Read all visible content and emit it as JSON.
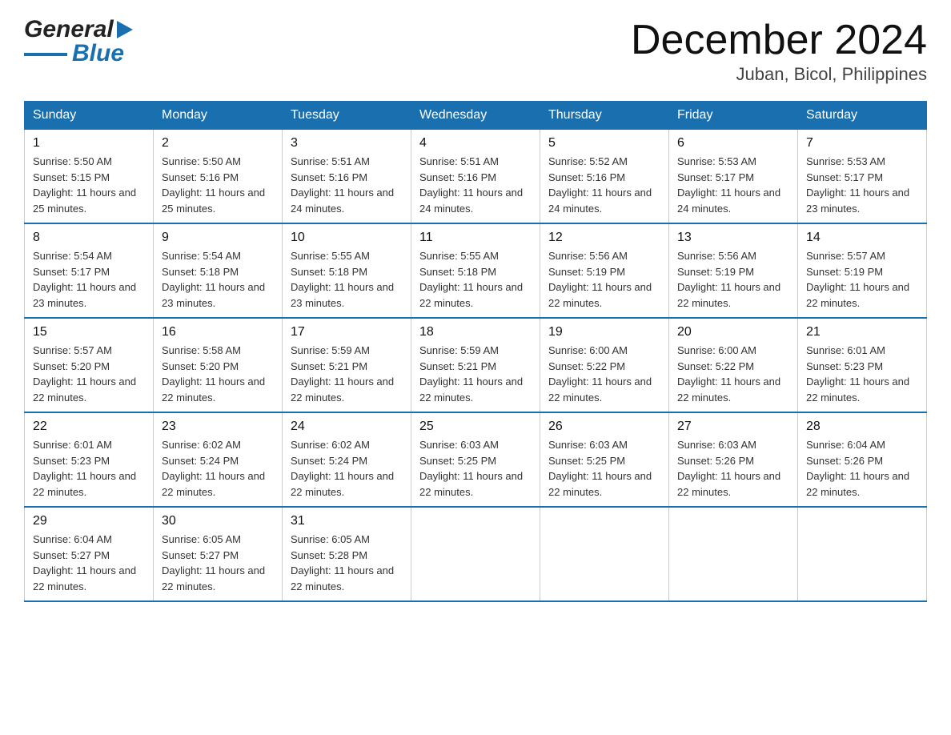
{
  "header": {
    "logo_general": "General",
    "logo_blue": "Blue",
    "month_title": "December 2024",
    "location": "Juban, Bicol, Philippines"
  },
  "calendar": {
    "days_of_week": [
      "Sunday",
      "Monday",
      "Tuesday",
      "Wednesday",
      "Thursday",
      "Friday",
      "Saturday"
    ],
    "weeks": [
      [
        {
          "day": "1",
          "sunrise": "Sunrise: 5:50 AM",
          "sunset": "Sunset: 5:15 PM",
          "daylight": "Daylight: 11 hours and 25 minutes."
        },
        {
          "day": "2",
          "sunrise": "Sunrise: 5:50 AM",
          "sunset": "Sunset: 5:16 PM",
          "daylight": "Daylight: 11 hours and 25 minutes."
        },
        {
          "day": "3",
          "sunrise": "Sunrise: 5:51 AM",
          "sunset": "Sunset: 5:16 PM",
          "daylight": "Daylight: 11 hours and 24 minutes."
        },
        {
          "day": "4",
          "sunrise": "Sunrise: 5:51 AM",
          "sunset": "Sunset: 5:16 PM",
          "daylight": "Daylight: 11 hours and 24 minutes."
        },
        {
          "day": "5",
          "sunrise": "Sunrise: 5:52 AM",
          "sunset": "Sunset: 5:16 PM",
          "daylight": "Daylight: 11 hours and 24 minutes."
        },
        {
          "day": "6",
          "sunrise": "Sunrise: 5:53 AM",
          "sunset": "Sunset: 5:17 PM",
          "daylight": "Daylight: 11 hours and 24 minutes."
        },
        {
          "day": "7",
          "sunrise": "Sunrise: 5:53 AM",
          "sunset": "Sunset: 5:17 PM",
          "daylight": "Daylight: 11 hours and 23 minutes."
        }
      ],
      [
        {
          "day": "8",
          "sunrise": "Sunrise: 5:54 AM",
          "sunset": "Sunset: 5:17 PM",
          "daylight": "Daylight: 11 hours and 23 minutes."
        },
        {
          "day": "9",
          "sunrise": "Sunrise: 5:54 AM",
          "sunset": "Sunset: 5:18 PM",
          "daylight": "Daylight: 11 hours and 23 minutes."
        },
        {
          "day": "10",
          "sunrise": "Sunrise: 5:55 AM",
          "sunset": "Sunset: 5:18 PM",
          "daylight": "Daylight: 11 hours and 23 minutes."
        },
        {
          "day": "11",
          "sunrise": "Sunrise: 5:55 AM",
          "sunset": "Sunset: 5:18 PM",
          "daylight": "Daylight: 11 hours and 22 minutes."
        },
        {
          "day": "12",
          "sunrise": "Sunrise: 5:56 AM",
          "sunset": "Sunset: 5:19 PM",
          "daylight": "Daylight: 11 hours and 22 minutes."
        },
        {
          "day": "13",
          "sunrise": "Sunrise: 5:56 AM",
          "sunset": "Sunset: 5:19 PM",
          "daylight": "Daylight: 11 hours and 22 minutes."
        },
        {
          "day": "14",
          "sunrise": "Sunrise: 5:57 AM",
          "sunset": "Sunset: 5:19 PM",
          "daylight": "Daylight: 11 hours and 22 minutes."
        }
      ],
      [
        {
          "day": "15",
          "sunrise": "Sunrise: 5:57 AM",
          "sunset": "Sunset: 5:20 PM",
          "daylight": "Daylight: 11 hours and 22 minutes."
        },
        {
          "day": "16",
          "sunrise": "Sunrise: 5:58 AM",
          "sunset": "Sunset: 5:20 PM",
          "daylight": "Daylight: 11 hours and 22 minutes."
        },
        {
          "day": "17",
          "sunrise": "Sunrise: 5:59 AM",
          "sunset": "Sunset: 5:21 PM",
          "daylight": "Daylight: 11 hours and 22 minutes."
        },
        {
          "day": "18",
          "sunrise": "Sunrise: 5:59 AM",
          "sunset": "Sunset: 5:21 PM",
          "daylight": "Daylight: 11 hours and 22 minutes."
        },
        {
          "day": "19",
          "sunrise": "Sunrise: 6:00 AM",
          "sunset": "Sunset: 5:22 PM",
          "daylight": "Daylight: 11 hours and 22 minutes."
        },
        {
          "day": "20",
          "sunrise": "Sunrise: 6:00 AM",
          "sunset": "Sunset: 5:22 PM",
          "daylight": "Daylight: 11 hours and 22 minutes."
        },
        {
          "day": "21",
          "sunrise": "Sunrise: 6:01 AM",
          "sunset": "Sunset: 5:23 PM",
          "daylight": "Daylight: 11 hours and 22 minutes."
        }
      ],
      [
        {
          "day": "22",
          "sunrise": "Sunrise: 6:01 AM",
          "sunset": "Sunset: 5:23 PM",
          "daylight": "Daylight: 11 hours and 22 minutes."
        },
        {
          "day": "23",
          "sunrise": "Sunrise: 6:02 AM",
          "sunset": "Sunset: 5:24 PM",
          "daylight": "Daylight: 11 hours and 22 minutes."
        },
        {
          "day": "24",
          "sunrise": "Sunrise: 6:02 AM",
          "sunset": "Sunset: 5:24 PM",
          "daylight": "Daylight: 11 hours and 22 minutes."
        },
        {
          "day": "25",
          "sunrise": "Sunrise: 6:03 AM",
          "sunset": "Sunset: 5:25 PM",
          "daylight": "Daylight: 11 hours and 22 minutes."
        },
        {
          "day": "26",
          "sunrise": "Sunrise: 6:03 AM",
          "sunset": "Sunset: 5:25 PM",
          "daylight": "Daylight: 11 hours and 22 minutes."
        },
        {
          "day": "27",
          "sunrise": "Sunrise: 6:03 AM",
          "sunset": "Sunset: 5:26 PM",
          "daylight": "Daylight: 11 hours and 22 minutes."
        },
        {
          "day": "28",
          "sunrise": "Sunrise: 6:04 AM",
          "sunset": "Sunset: 5:26 PM",
          "daylight": "Daylight: 11 hours and 22 minutes."
        }
      ],
      [
        {
          "day": "29",
          "sunrise": "Sunrise: 6:04 AM",
          "sunset": "Sunset: 5:27 PM",
          "daylight": "Daylight: 11 hours and 22 minutes."
        },
        {
          "day": "30",
          "sunrise": "Sunrise: 6:05 AM",
          "sunset": "Sunset: 5:27 PM",
          "daylight": "Daylight: 11 hours and 22 minutes."
        },
        {
          "day": "31",
          "sunrise": "Sunrise: 6:05 AM",
          "sunset": "Sunset: 5:28 PM",
          "daylight": "Daylight: 11 hours and 22 minutes."
        },
        {
          "day": "",
          "sunrise": "",
          "sunset": "",
          "daylight": ""
        },
        {
          "day": "",
          "sunrise": "",
          "sunset": "",
          "daylight": ""
        },
        {
          "day": "",
          "sunrise": "",
          "sunset": "",
          "daylight": ""
        },
        {
          "day": "",
          "sunrise": "",
          "sunset": "",
          "daylight": ""
        }
      ]
    ]
  }
}
